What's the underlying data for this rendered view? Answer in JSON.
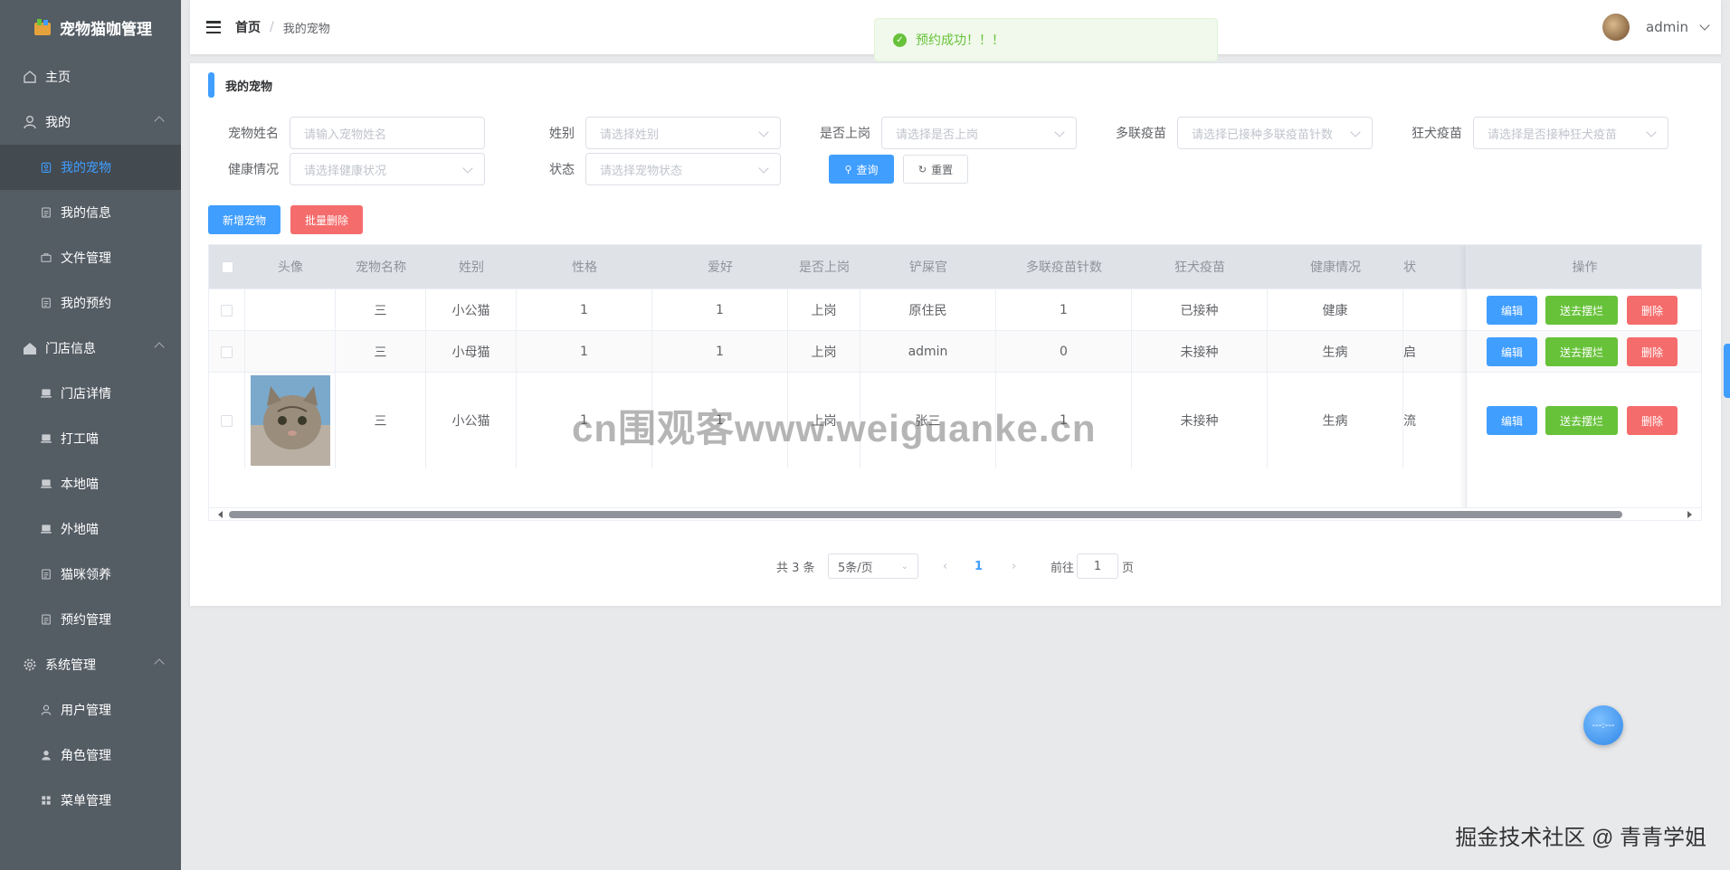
{
  "app": {
    "title": "宠物猫咖管理",
    "primary_color": "#409eff"
  },
  "sidebar": {
    "items": [
      {
        "label": "主页",
        "type": "top",
        "icon": "home-icon"
      },
      {
        "label": "我的",
        "type": "top",
        "icon": "user-icon",
        "expandable": true
      },
      {
        "label": "我的宠物",
        "type": "sub",
        "icon": "pet-icon",
        "active": true
      },
      {
        "label": "我的信息",
        "type": "sub",
        "icon": "document-icon"
      },
      {
        "label": "文件管理",
        "type": "sub",
        "icon": "briefcase-icon"
      },
      {
        "label": "我的预约",
        "type": "sub",
        "icon": "document-icon"
      },
      {
        "label": "门店信息",
        "type": "top",
        "icon": "house-icon",
        "expandable": true
      },
      {
        "label": "门店详情",
        "type": "sub",
        "icon": "laptop-icon"
      },
      {
        "label": "打工喵",
        "type": "sub",
        "icon": "laptop-icon"
      },
      {
        "label": "本地喵",
        "type": "sub",
        "icon": "laptop-icon"
      },
      {
        "label": "外地喵",
        "type": "sub",
        "icon": "laptop-icon"
      },
      {
        "label": "猫咪领养",
        "type": "sub",
        "icon": "document-icon"
      },
      {
        "label": "预约管理",
        "type": "sub",
        "icon": "document-icon"
      },
      {
        "label": "系统管理",
        "type": "top",
        "icon": "gear-icon",
        "expandable": true
      },
      {
        "label": "用户管理",
        "type": "sub",
        "icon": "user-icon"
      },
      {
        "label": "角色管理",
        "type": "sub",
        "icon": "user-solid-icon"
      },
      {
        "label": "菜单管理",
        "type": "sub",
        "icon": "grid-icon"
      }
    ]
  },
  "header": {
    "breadcrumb_home": "首页",
    "breadcrumb_sep": "/",
    "breadcrumb_current": "我的宠物",
    "username": "admin"
  },
  "toast": {
    "message": "预约成功！！！"
  },
  "page": {
    "title": "我的宠物"
  },
  "filters": {
    "pet_name": {
      "label": "宠物姓名",
      "placeholder": "请输入宠物姓名"
    },
    "gender": {
      "label": "姓别",
      "placeholder": "请选择姓别"
    },
    "on_duty": {
      "label": "是否上岗",
      "placeholder": "请选择是否上岗"
    },
    "multi_vaccine": {
      "label": "多联疫苗",
      "placeholder": "请选择已接种多联疫苗针数"
    },
    "rabies_vaccine": {
      "label": "狂犬疫苗",
      "placeholder": "请选择是否接种狂犬疫苗"
    },
    "health": {
      "label": "健康情况",
      "placeholder": "请选择健康状况"
    },
    "status": {
      "label": "状态",
      "placeholder": "请选择宠物状态"
    },
    "query_label": "查询",
    "reset_label": "重置"
  },
  "actions": {
    "add_label": "新增宠物",
    "batch_delete_label": "批量删除"
  },
  "table": {
    "headers": [
      "头像",
      "宠物名称",
      "姓别",
      "性格",
      "爱好",
      "是否上岗",
      "铲屎官",
      "多联疫苗针数",
      "狂犬疫苗",
      "健康情况",
      "状",
      "操作"
    ],
    "rows": [
      {
        "avatar": false,
        "name": "三",
        "gender": "小公猫",
        "personality": "1",
        "hobby": "1",
        "on_duty": "上岗",
        "owner": "原住民",
        "vaccine_count": "1",
        "rabies": "已接种",
        "health": "健康",
        "status": ""
      },
      {
        "avatar": false,
        "name": "三",
        "gender": "小母猫",
        "personality": "1",
        "hobby": "1",
        "on_duty": "上岗",
        "owner": "admin",
        "vaccine_count": "0",
        "rabies": "未接种",
        "health": "生病",
        "status": "启"
      },
      {
        "avatar": true,
        "name": "三",
        "gender": "小公猫",
        "personality": "1",
        "hobby": "1",
        "on_duty": "上岗",
        "owner": "张三",
        "vaccine_count": "1",
        "rabies": "未接种",
        "health": "生病",
        "status": "流"
      }
    ],
    "row_actions": {
      "edit": "编辑",
      "send": "送去摆烂",
      "delete": "删除"
    }
  },
  "pagination": {
    "total_text": "共 3 条",
    "page_size": "5条/页",
    "current_page": "1",
    "goto_prefix": "前往",
    "goto_value": "1",
    "goto_suffix": "页"
  },
  "overlay": {
    "watermark": "cn围观客www.weiguanke.cn",
    "credit": "掘金技术社区 @ 青青学姐",
    "float_text": "---:---"
  }
}
